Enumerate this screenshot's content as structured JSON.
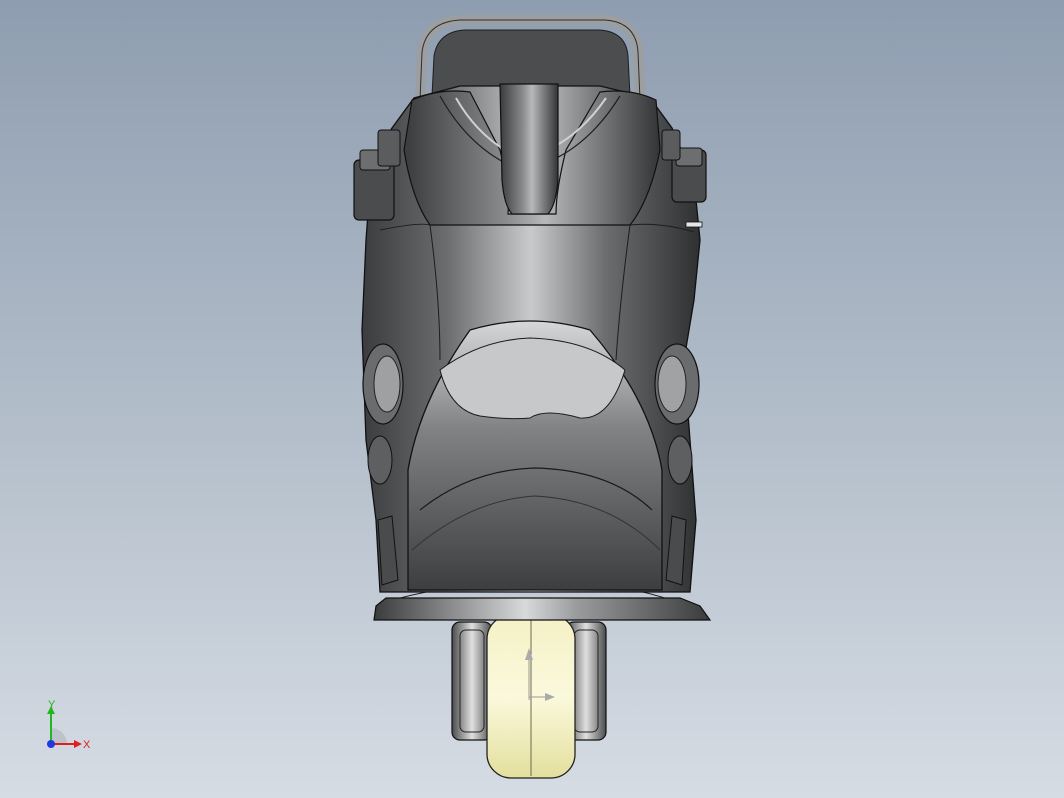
{
  "viewport": {
    "background_top": "#8e9db0",
    "background_bottom": "#d6dce4"
  },
  "model": {
    "body_color": "#5f6163",
    "highlight_color": "#d9dadb",
    "shadow_color": "#2a2b2c",
    "wheel_color": "#f3f0c4",
    "wheel_hub_color": "#c9c9c9"
  },
  "triad": {
    "x_label": "X",
    "y_label": "Y",
    "x_color": "#e02020",
    "y_color": "#1fb81f",
    "z_color": "#1e3be0"
  }
}
